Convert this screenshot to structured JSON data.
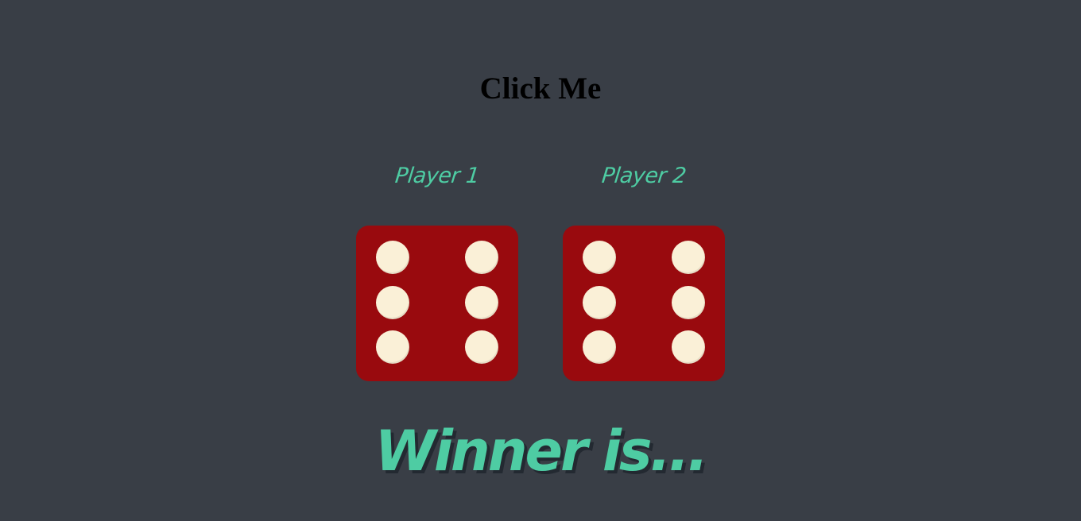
{
  "header": {
    "click_label": "Click Me"
  },
  "players": [
    {
      "label": "Player 1",
      "dice_value": 6
    },
    {
      "label": "Player 2",
      "dice_value": 6
    }
  ],
  "result": {
    "text": "Winner is..."
  },
  "colors": {
    "background": "#393E46",
    "accent": "#4ECCA3",
    "dice_face": "#990A0E",
    "dice_pip": "#FAF0D7",
    "title_text": "#000000"
  },
  "icons": {
    "dice": "dice-six-icon"
  }
}
